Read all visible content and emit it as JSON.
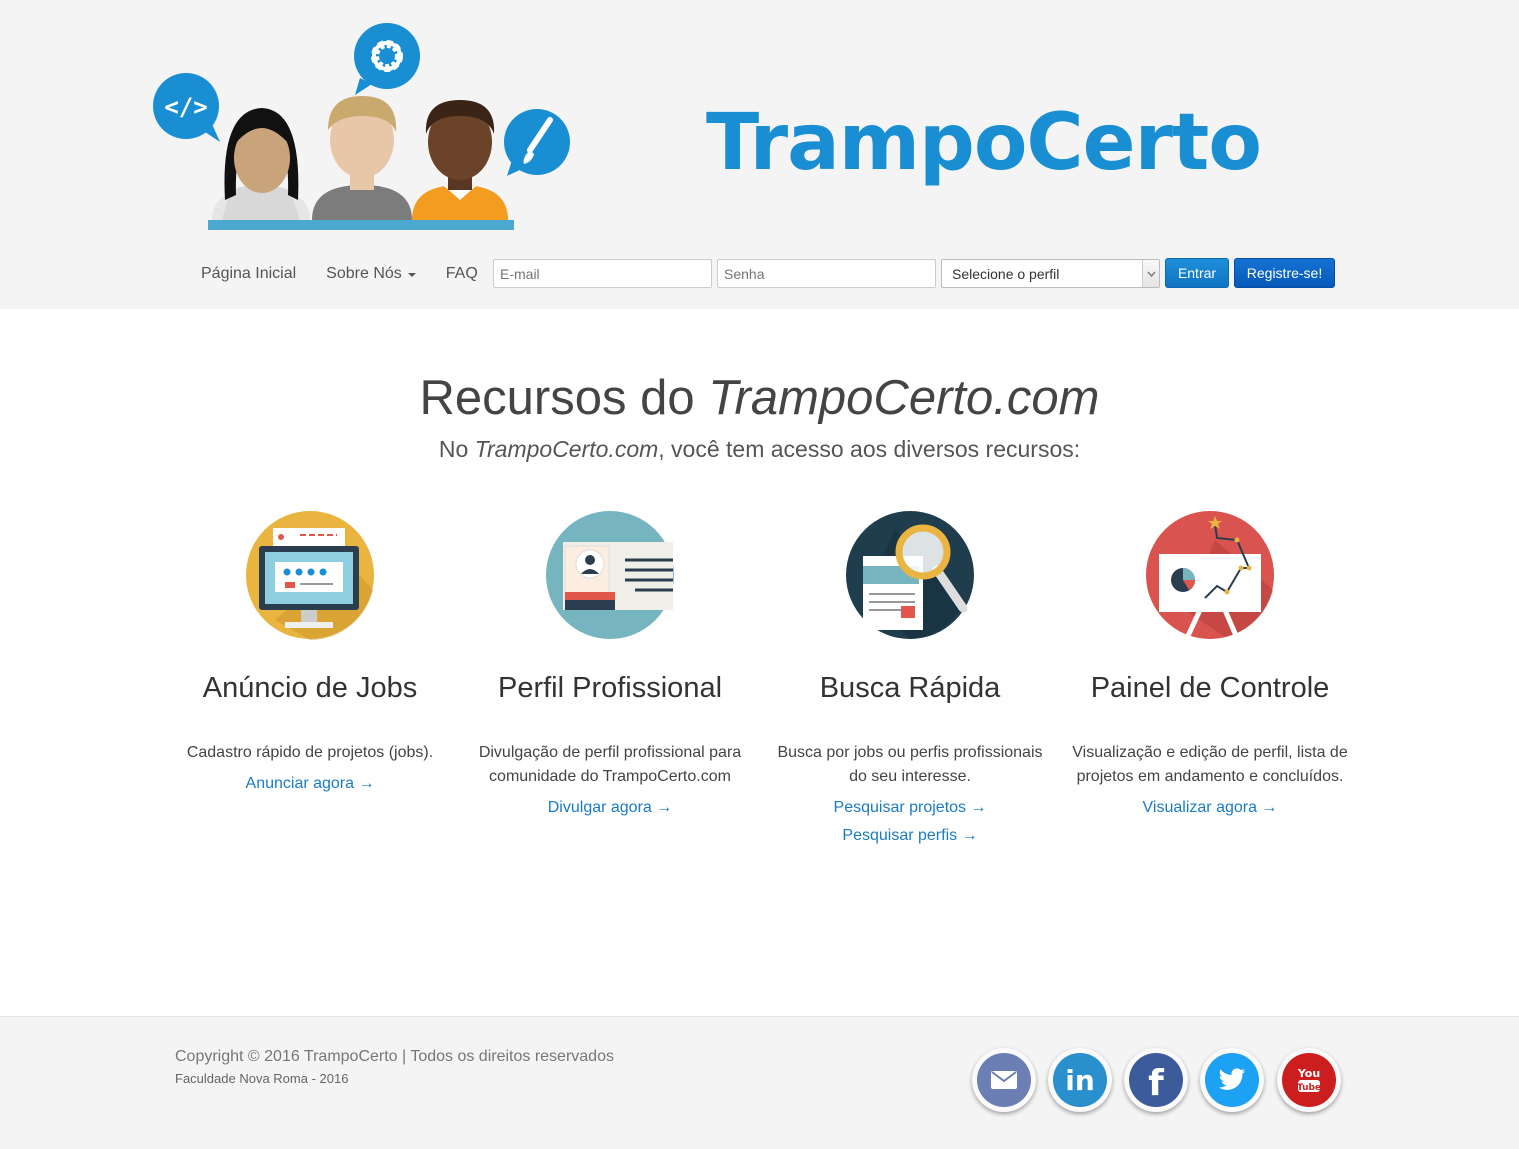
{
  "header": {
    "brand": "TrampoCerto",
    "nav": {
      "home": "Página Inicial",
      "about": "Sobre Nós",
      "faq": "FAQ"
    },
    "login": {
      "email_placeholder": "E-mail",
      "password_placeholder": "Senha",
      "profile_select": "Selecione o perfil",
      "login_button": "Entrar",
      "register_button": "Registre-se!"
    }
  },
  "main": {
    "title_prefix": "Recursos do ",
    "title_brand": "TrampoCerto.com",
    "subtitle_prefix": "No ",
    "subtitle_brand": "TrampoCerto.com",
    "subtitle_suffix": ", você tem acesso aos diversos recursos:",
    "features": [
      {
        "title": "Anúncio de Jobs",
        "description": "Cadastro rápido de projetos (jobs).",
        "links": [
          "Anunciar agora →"
        ],
        "icon": "monitor-icon",
        "color": "#e9b43f"
      },
      {
        "title": "Perfil Profissional",
        "description": "Divulgação de perfil profissional para comunidade do TrampoCerto.com",
        "links": [
          "Divulgar agora →"
        ],
        "icon": "profile-card-icon",
        "color": "#76b5c0"
      },
      {
        "title": "Busca Rápida",
        "description": "Busca por jobs ou perfis profissionais do seu interesse.",
        "links": [
          "Pesquisar projetos →",
          "Pesquisar perfis →"
        ],
        "icon": "magnifier-icon",
        "color": "#1f3d4c"
      },
      {
        "title": "Painel de Controle",
        "description": "Visualização e edição de perfil, lista de projetos em andamento e concluídos.",
        "links": [
          "Visualizar agora →"
        ],
        "icon": "dashboard-icon",
        "color": "#d9534f"
      }
    ]
  },
  "footer": {
    "copyright": "Copyright © 2016 TrampoCerto | Todos os direitos reservados",
    "institution": "Faculdade Nova Roma - 2016",
    "social": [
      {
        "name": "email-icon",
        "color": "#6c7fb4"
      },
      {
        "name": "linkedin-icon",
        "color": "#2a8fcd"
      },
      {
        "name": "facebook-icon",
        "color": "#3b5b9a"
      },
      {
        "name": "twitter-icon",
        "color": "#1da1f2"
      },
      {
        "name": "youtube-icon",
        "color": "#cc1e1e"
      }
    ]
  },
  "colors": {
    "brand": "#1a8ed3",
    "link": "#1a7bc4",
    "header_bg": "#f4f4f4"
  }
}
